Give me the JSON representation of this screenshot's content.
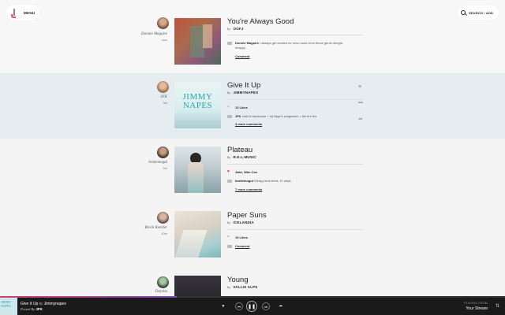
{
  "header": {
    "menu_label": "MENU",
    "search_label": "SEARCH / ADD"
  },
  "feed": [
    {
      "title": "You're Always Good",
      "by_word": "by",
      "artist": "OOFJ",
      "poster": "Donnie Maguire",
      "ago": "now",
      "comment_user": "Donnie Maguire",
      "comment_text": "I always get excited for new music from these gents #bright #happy",
      "action": "Comment"
    },
    {
      "title": "Give It Up",
      "by_word": "by",
      "artist": "JIMMYNAPES",
      "poster": "JFK",
      "ago": "3m",
      "likes": "12 Likes",
      "comment_user": "JFK",
      "comment_text": "Half of disclosure + mj blige's songwriter = fire fire fire",
      "more": "3 more comments",
      "art_text": "JIMMY NAPES"
    },
    {
      "title": "Plateau",
      "by_word": "by",
      "artist": "R.E.L.MUSIC",
      "poster": "brokemogul",
      "ago": "5m",
      "likes": "Jake, Wim Cox",
      "comment_user": "brokemogul",
      "comment_text": "Sleepy time feels, if I slept.",
      "more": "7 more comments"
    },
    {
      "title": "Paper Suns",
      "by_word": "by",
      "artist": "ICELANDIA",
      "poster": "Brock Kenzler",
      "ago": "10m",
      "likes": "10 Likes",
      "action": "Comment"
    },
    {
      "title": "Young",
      "by_word": "by",
      "artist": "VALLIS ALPS",
      "poster": "Daysha"
    }
  ],
  "player": {
    "track": "Give It Up",
    "by_word": "by",
    "artist": "Jimmynapes",
    "posted_label": "Posted By",
    "poster": "JFK",
    "playing_from": "PLAYING FROM",
    "source": "Your Stream",
    "art_text": "JIMMY NAPES",
    "progress": 0.35
  }
}
